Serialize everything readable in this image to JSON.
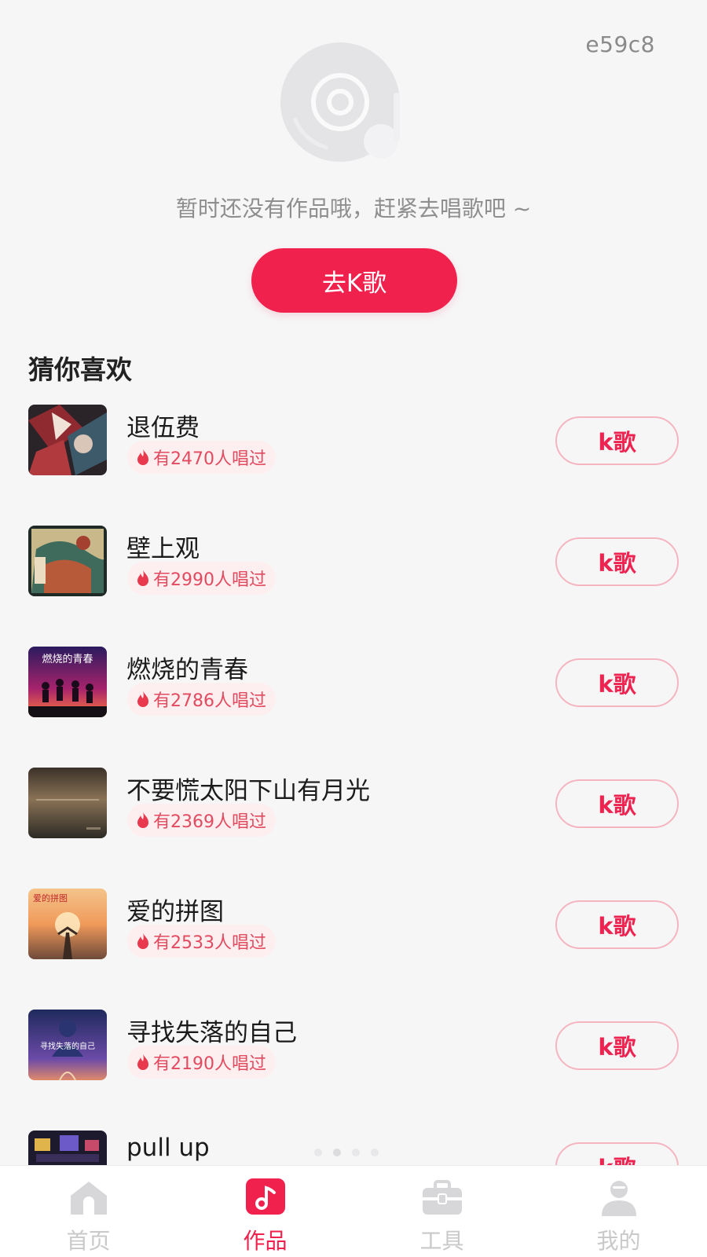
{
  "device_id": "e59c8",
  "empty_state": {
    "message": "暂时还没有作品哦，赶紧去唱歌吧 ~",
    "button_label": "去K歌"
  },
  "recommend": {
    "title": "猜你喜欢",
    "button_label": "k歌",
    "songs": [
      {
        "title": "退伍费",
        "sung": "有2470人唱过"
      },
      {
        "title": "壁上观",
        "sung": "有2990人唱过"
      },
      {
        "title": "燃烧的青春",
        "sung": "有2786人唱过",
        "cover_text": "燃烧的青春"
      },
      {
        "title": "不要慌太阳下山有月光",
        "sung": "有2369人唱过"
      },
      {
        "title": "爱的拼图",
        "sung": "有2533人唱过",
        "cover_text": "爱的拼图"
      },
      {
        "title": "寻找失落的自己",
        "sung": "有2190人唱过",
        "cover_text": "寻找失落的自己"
      },
      {
        "title": "pull up",
        "sung": ""
      }
    ]
  },
  "tabs": [
    {
      "label": "首页",
      "icon": "home-icon",
      "active": false
    },
    {
      "label": "作品",
      "icon": "music-note-icon",
      "active": true
    },
    {
      "label": "工具",
      "icon": "toolbox-icon",
      "active": false
    },
    {
      "label": "我的",
      "icon": "user-icon",
      "active": false
    }
  ],
  "colors": {
    "accent": "#f1214e",
    "badge_bg": "#fdeff0",
    "badge_text": "#e24a5f",
    "inactive_tab": "#c9c9c9"
  }
}
